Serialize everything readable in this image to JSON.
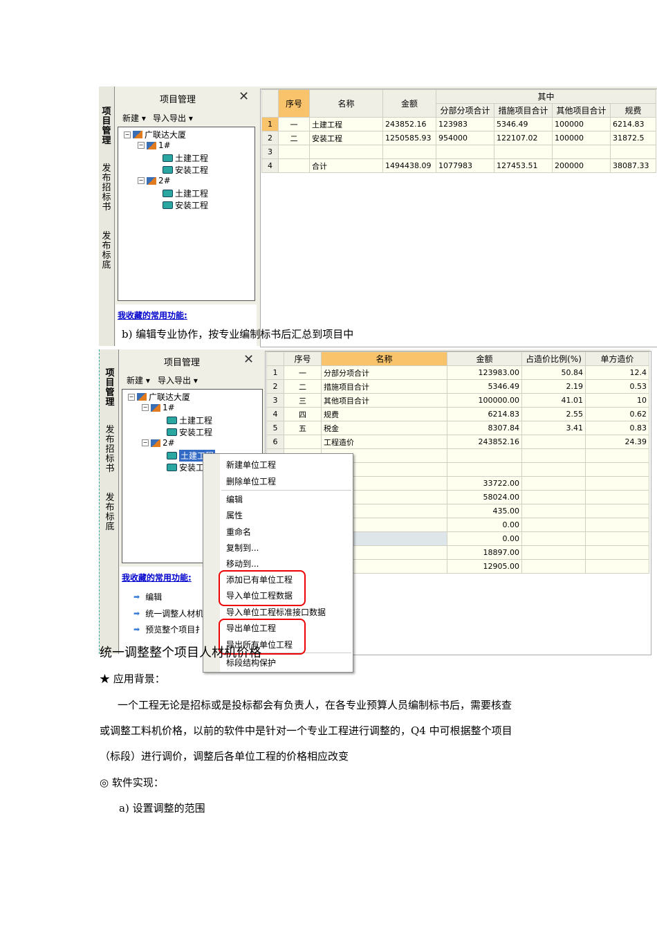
{
  "screenshot1": {
    "tabs": [
      "项目管理",
      "发布招标书",
      "发布标底"
    ],
    "panel_title": "项目管理",
    "toolbar": {
      "new": "新建 ▾",
      "import_export": "导入导出 ▾"
    },
    "tree": {
      "root": "广联达大厦",
      "b1": "1#",
      "b2": "2#",
      "civil": "土建工程",
      "install": "安装工程"
    },
    "favorites_title": "我收藏的常用功能:",
    "table": {
      "headers": {
        "seq": "序号",
        "name": "名称",
        "amount": "金额",
        "group": "其中",
        "sub": [
          "分部分项合计",
          "措施项目合计",
          "其他项目合计",
          "规费"
        ]
      },
      "rows": [
        [
          "1",
          "一",
          "土建工程",
          "243852.16",
          "123983",
          "5346.49",
          "100000",
          "6214.83"
        ],
        [
          "2",
          "二",
          "安装工程",
          "1250585.93",
          "954000",
          "122107.02",
          "100000",
          "31872.5"
        ],
        [
          "3",
          "",
          "",
          "",
          "",
          "",
          "",
          ""
        ],
        [
          "4",
          "",
          "合计",
          "1494438.09",
          "1077983",
          "127453.51",
          "200000",
          "38087.33"
        ]
      ]
    }
  },
  "caption_b": "b)  编辑专业协作，按专业编制标书后汇总到项目中",
  "screenshot2": {
    "tabs": [
      "项目管理",
      "发布招标书",
      "发布标底"
    ],
    "panel_title": "项目管理",
    "toolbar": {
      "new": "新建 ▾",
      "import_export": "导入导出 ▾"
    },
    "tree": {
      "root": "广联达大厦",
      "b1": "1#",
      "b2": "2#",
      "civil": "土建工程",
      "install": "安装工程",
      "civil_sel": "土建工程",
      "install_cut": "安装工"
    },
    "favorites_title": "我收藏的常用功能:",
    "favorites": [
      "编辑",
      "统一调整人材机",
      "预览整个项目扌"
    ],
    "table": {
      "headers": [
        "序号",
        "名称",
        "金额",
        "占造价比例(%)",
        "单方造价"
      ],
      "rows": [
        [
          "1",
          "一",
          "分部分项合计",
          "123983.00",
          "50.84",
          "12.4"
        ],
        [
          "2",
          "二",
          "措施项目合计",
          "5346.49",
          "2.19",
          "0.53"
        ],
        [
          "3",
          "三",
          "其他项目合计",
          "100000.00",
          "41.01",
          "10"
        ],
        [
          "4",
          "四",
          "规费",
          "6214.83",
          "2.55",
          "0.62"
        ],
        [
          "5",
          "五",
          "税金",
          "8307.84",
          "3.41",
          "0.83"
        ],
        [
          "6",
          "",
          "工程造价",
          "243852.16",
          "",
          "24.39"
        ],
        [
          "",
          "",
          "",
          "",
          "",
          ""
        ],
        [
          "",
          "",
          "",
          "",
          "",
          ""
        ],
        [
          "",
          "",
          "",
          "33722.00",
          "",
          ""
        ],
        [
          "",
          "",
          "",
          "58024.00",
          "",
          ""
        ],
        [
          "",
          "",
          "",
          "435.00",
          "",
          ""
        ],
        [
          "",
          "",
          "",
          "0.00",
          "",
          ""
        ],
        [
          "",
          "",
          "",
          "0.00",
          "",
          ""
        ],
        [
          "",
          "",
          "",
          "18897.00",
          "",
          ""
        ],
        [
          "",
          "",
          "",
          "12905.00",
          "",
          ""
        ]
      ]
    },
    "context_menu": [
      "新建单位工程",
      "删除单位工程",
      "编辑",
      "属性",
      "重命名",
      "复制到...",
      "移动到...",
      "添加已有单位工程",
      "导入单位工程数据",
      "导入单位工程标准接口数据",
      "导出单位工程",
      "导出所有单位工程",
      "标段结构保护"
    ]
  },
  "section_title": "统一调整整个项目人材机价格",
  "background_label": "★  应用背景：",
  "para1": "一个工程无论是招标或是投标都会有负责人，在各专业预算人员编制标书后，需要核查",
  "para2": "或调整工料机价格，以前的软件中是针对一个专业工程进行调整的，Q4 中可根据整个项目",
  "para3": "（标段）进行调价，调整后各单位工程的价格相应改变",
  "impl_label": "◎   软件实现：",
  "step_a": "a)    设置调整的范围"
}
